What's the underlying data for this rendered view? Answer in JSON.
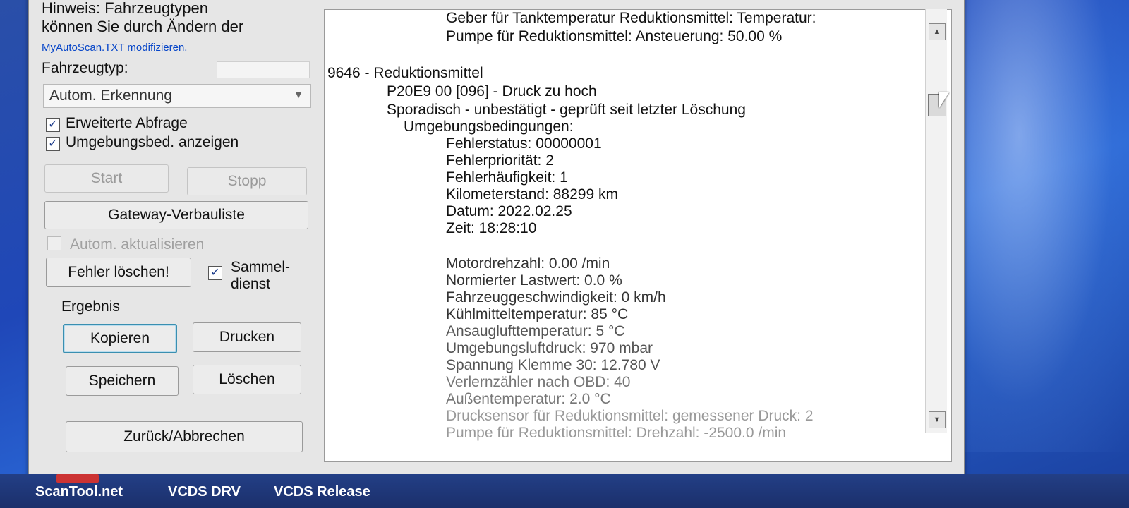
{
  "left": {
    "hint_line1": "Hinweis: Fahrzeugtypen",
    "hint_line2": "können Sie durch Ändern der",
    "hint_link": "MyAutoScan.TXT modifizieren.",
    "vehicle_type_label": "Fahrzeugtyp:",
    "vehicle_type_value": "Autom. Erkennung",
    "extended_query_label": "Erweiterte Abfrage",
    "show_env_label": "Umgebungsbed. anzeigen",
    "start_label": "Start",
    "stop_label": "Stopp",
    "gateway_label": "Gateway-Verbauliste",
    "auto_update_label": "Autom. aktualisieren",
    "clear_faults_label": "Fehler löschen!",
    "collective_label_1": "Sammel-",
    "collective_label_2": "dienst",
    "result_label": "Ergebnis",
    "copy_label": "Kopieren",
    "print_label": "Drucken",
    "save_label": "Speichern",
    "delete_label": "Löschen",
    "back_label": "Zurück/Abbrechen"
  },
  "output_lines": [
    "Geber für Tanktemperatur Reduktionsmittel: Temperatur:",
    "Pumpe für Reduktionsmittel: Ansteuerung: 50.00 %",
    "9646 - Reduktionsmittel",
    "P20E9 00 [096] - Druck zu hoch",
    "Sporadisch - unbestätigt - geprüft seit letzter Löschung",
    "Umgebungsbedingungen:",
    "Fehlerstatus: 00000001",
    "Fehlerpriorität: 2",
    "Fehlerhäufigkeit: 1",
    "Kilometerstand: 88299 km",
    "Datum: 2022.02.25",
    "Zeit: 18:28:10",
    "Motordrehzahl: 0.00 /min",
    "Normierter Lastwert: 0.0 %",
    "Fahrzeuggeschwindigkeit: 0 km/h",
    "Kühlmitteltemperatur: 85 °C",
    "Ansauglufttemperatur: 5 °C",
    "Umgebungsluftdruck: 970 mbar",
    "Spannung Klemme 30: 12.780 V",
    "Verlernzähler nach OBD: 40",
    "Außentemperatur: 2.0 °C",
    "Drucksensor für Reduktionsmittel: gemessener Druck: 2",
    "Pumpe für Reduktionsmittel: Drehzahl: -2500.0 /min"
  ],
  "taskbar": {
    "item1": "ScanTool.net",
    "item2": "VCDS DRV",
    "item3": "VCDS Release"
  },
  "icons": {
    "scroll_up": "scroll-up-icon",
    "scroll_down": "scroll-down-icon",
    "checkbox": "checkmark-icon",
    "dropdown": "chevron-down-icon"
  }
}
